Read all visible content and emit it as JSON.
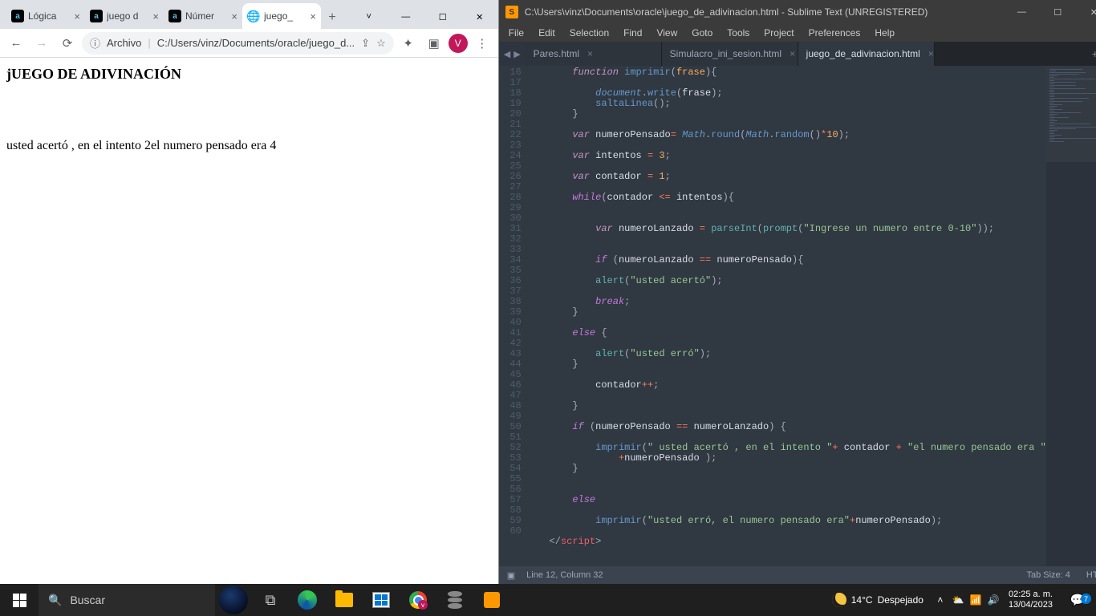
{
  "chrome": {
    "tabs": [
      {
        "title": "Lógica",
        "favicon": "a"
      },
      {
        "title": "juego d",
        "favicon": "a"
      },
      {
        "title": "Númer",
        "favicon": "a"
      },
      {
        "title": "juego_",
        "favicon": "globe",
        "active": true
      }
    ],
    "back": "←",
    "forward": "→",
    "reload": "⟳",
    "info_icon": "ⓘ",
    "url_prefix": "Archivo",
    "url_sep": "|",
    "url": "C:/Users/vinz/Documents/oracle/juego_d...",
    "share": "⇪",
    "star": "☆",
    "ext": "✦",
    "panel": "▣",
    "avatar": "V",
    "menu": "⋮",
    "page_heading": "jUEGO DE ADIVINACIÓN",
    "page_text": "usted acertó , en el intento 2el numero pensado era 4"
  },
  "sublime": {
    "title": "C:\\Users\\vinz\\Documents\\oracle\\juego_de_adivinacion.html - Sublime Text (UNREGISTERED)",
    "menu": [
      "File",
      "Edit",
      "Selection",
      "Find",
      "View",
      "Goto",
      "Tools",
      "Project",
      "Preferences",
      "Help"
    ],
    "tabs": [
      {
        "name": "Pares.html",
        "close": "×"
      },
      {
        "name": "Simulacro_ini_sesion.html",
        "close": "×"
      },
      {
        "name": "juego_de_adivinacion.html",
        "close": "×",
        "active": true
      }
    ],
    "nav_prev": "◀",
    "nav_next": "▶",
    "tab_plus": "+",
    "tab_drop": "▾",
    "first_line": 16,
    "status_left_icon": "▣",
    "status_left": "Line 12, Column 32",
    "status_tab": "Tab Size: 4",
    "status_lang": "HTML"
  },
  "taskbar": {
    "search_placeholder": "Buscar",
    "weather_temp": "14°C",
    "weather_cond": "Despejado",
    "tray_up": "˄",
    "tray_cloud": "⛅",
    "tray_wifi": "📶",
    "tray_vol": "🔊",
    "time": "02:25 a. m.",
    "date": "13/04/2023",
    "notif_count": "7"
  }
}
